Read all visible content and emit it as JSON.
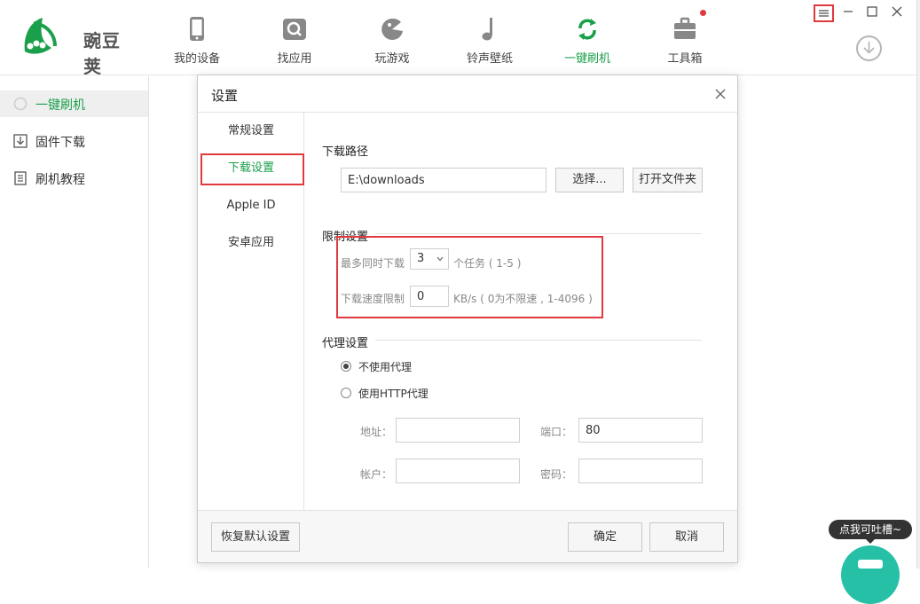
{
  "app": {
    "name": "豌豆荚"
  },
  "nav": [
    {
      "label": "我的设备",
      "icon": "phone-icon"
    },
    {
      "label": "找应用",
      "icon": "search-icon"
    },
    {
      "label": "玩游戏",
      "icon": "game-icon"
    },
    {
      "label": "铃声壁纸",
      "icon": "music-note-icon"
    },
    {
      "label": "一键刷机",
      "icon": "refresh-icon",
      "active": true
    },
    {
      "label": "工具箱",
      "icon": "toolbox-icon"
    }
  ],
  "sidebar": {
    "items": [
      {
        "label": "一键刷机",
        "icon": "circle-icon",
        "active": true
      },
      {
        "label": "固件下载",
        "icon": "download-icon"
      },
      {
        "label": "刷机教程",
        "icon": "document-icon"
      }
    ]
  },
  "dialog": {
    "title": "设置",
    "tabs": [
      {
        "label": "常规设置"
      },
      {
        "label": "下载设置",
        "selected": true
      },
      {
        "label": "Apple ID"
      },
      {
        "label": "安卓应用"
      }
    ],
    "download_path": {
      "heading": "下载路径",
      "value": "E:\\downloads",
      "choose_label": "选择...",
      "open_folder_label": "打开文件夹"
    },
    "limits": {
      "heading": "限制设置",
      "max_tasks_label": "最多同时下载",
      "max_tasks_value": "3",
      "max_tasks_unit": "个任务 ( 1-5 )",
      "speed_label": "下载速度限制",
      "speed_value": "0",
      "speed_unit": "KB/s ( 0为不限速 , 1-4096 )"
    },
    "proxy": {
      "heading": "代理设置",
      "no_proxy_label": "不使用代理",
      "http_proxy_label": "使用HTTP代理",
      "address_label": "地址：",
      "address_value": "",
      "port_label": "端口：",
      "port_value": "80",
      "account_label": "帐户：",
      "account_value": "",
      "password_label": "密码：",
      "password_value": ""
    },
    "footer": {
      "reset_label": "恢复默认设置",
      "ok_label": "确定",
      "cancel_label": "取消"
    }
  },
  "feedback": {
    "tooltip": "点我可吐槽~"
  },
  "colors": {
    "accent": "#1aa04a",
    "highlight": "#e0393e",
    "chat": "#26c0a6"
  }
}
